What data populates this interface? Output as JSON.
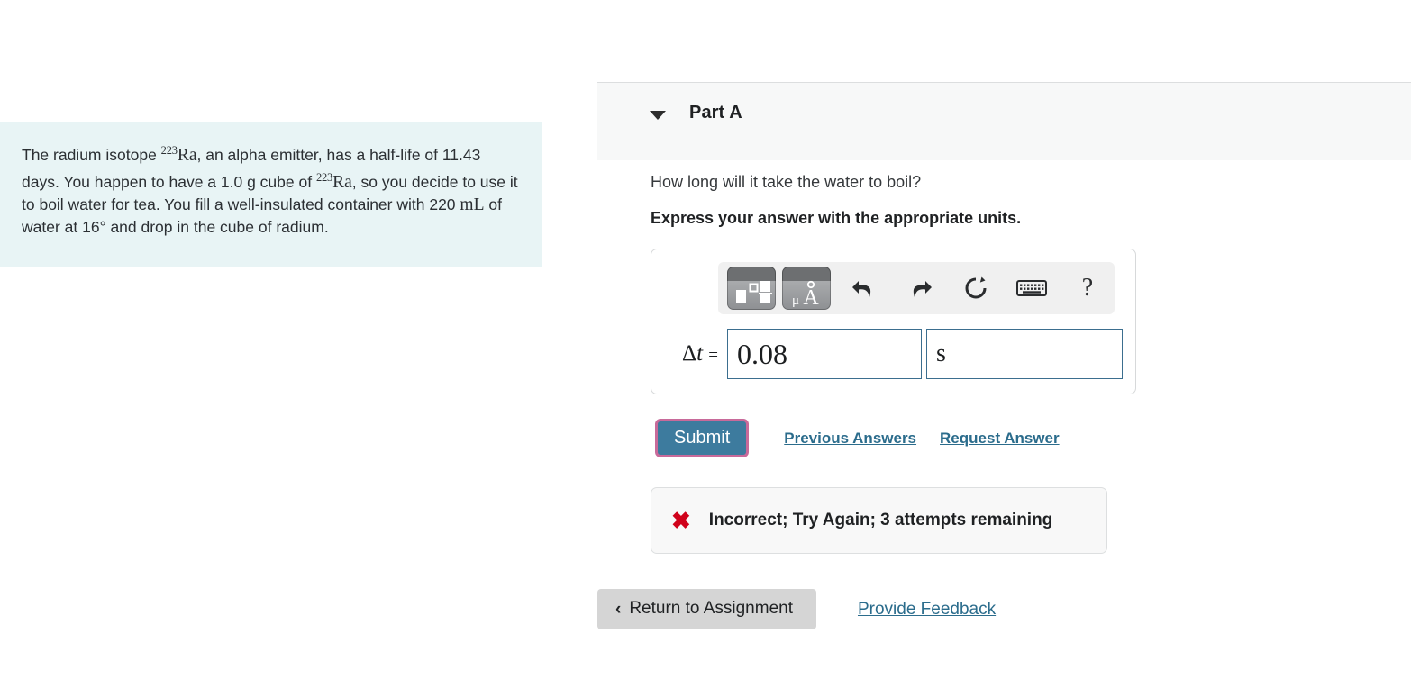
{
  "problem": {
    "text_part1": "The radium isotope ",
    "isotope_sup": "223",
    "isotope_symbol": "Ra",
    "text_part2": ", an alpha emitter, has a half-life of 11.43 days. You happen to have a 1.0 g cube of ",
    "isotope2_sup": "223",
    "isotope2_symbol": "Ra",
    "text_part3": ", so you decide to use it to boil water for tea. You fill a well-insulated container with 220 ",
    "volume_unit": "mL",
    "text_part4": " of water at 16",
    "degree": "°",
    "text_part5": " and drop in the cube of radium."
  },
  "part": {
    "title": "Part A",
    "caret_icon": "caret-down-icon",
    "question": "How long will it take the water to boil?",
    "instruction": "Express your answer with the appropriate units."
  },
  "answer": {
    "toolbar": {
      "template_button_icon": "math-template-icon",
      "units_button_icon": "units-angstrom-icon",
      "units_button_label": "μÅ",
      "undo_icon": "undo-icon",
      "redo_icon": "redo-icon",
      "reset_icon": "reset-icon",
      "keyboard_icon": "keyboard-icon",
      "help_icon": "help-icon",
      "help_label": "?"
    },
    "variable_label": "Δt",
    "equals": "=",
    "value": "0.08",
    "unit_value": "s",
    "value_placeholder": "",
    "unit_placeholder": ""
  },
  "actions": {
    "submit_label": "Submit",
    "previous_answers_label": "Previous Answers",
    "request_answer_label": "Request Answer"
  },
  "feedback": {
    "icon": "x-mark-icon",
    "icon_glyph": "✖",
    "message": "Incorrect; Try Again; 3 attempts remaining"
  },
  "footer": {
    "return_chevron": "‹",
    "return_label": "Return to Assignment",
    "provide_feedback_label": "Provide Feedback"
  },
  "colors": {
    "problem_bg": "#e8f4f5",
    "part_header_bg": "#f7f8f8",
    "submit_fill": "#3d7b9e",
    "submit_focus_ring": "#c86a9a",
    "link": "#2b6c8c",
    "error_x": "#d0021b",
    "input_border": "#3b6e8f",
    "return_btn_bg": "#d5d5d5"
  }
}
